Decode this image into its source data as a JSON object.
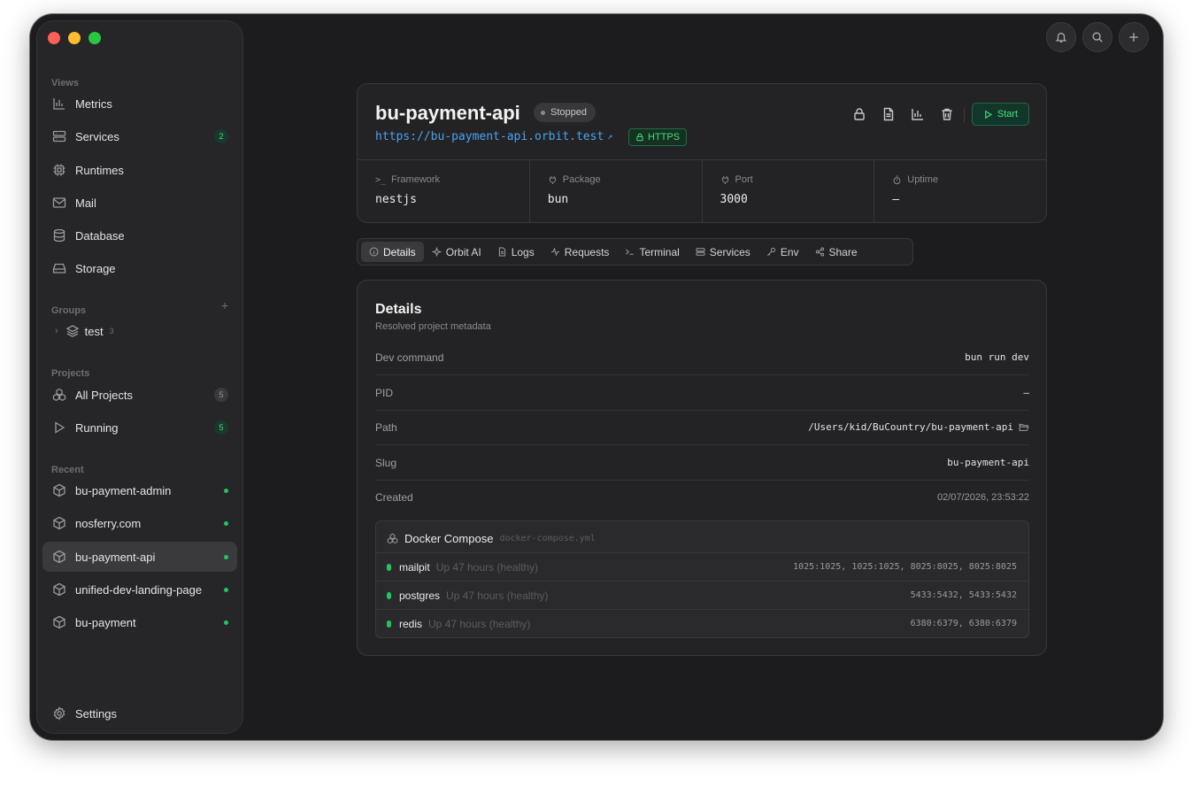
{
  "sidebar": {
    "views_label": "Views",
    "views": [
      {
        "label": "Metrics",
        "icon": "bar-chart-icon"
      },
      {
        "label": "Services",
        "icon": "server-icon",
        "badge": "2"
      },
      {
        "label": "Runtimes",
        "icon": "cpu-icon"
      },
      {
        "label": "Mail",
        "icon": "mail-icon"
      },
      {
        "label": "Database",
        "icon": "database-icon"
      },
      {
        "label": "Storage",
        "icon": "hard-drive-icon"
      }
    ],
    "groups_label": "Groups",
    "group": {
      "name": "test",
      "count": "3"
    },
    "projects_label": "Projects",
    "projects": [
      {
        "label": "All Projects",
        "badge": "5"
      },
      {
        "label": "Running",
        "badge": "5"
      }
    ],
    "recent_label": "Recent",
    "recent": [
      {
        "label": "bu-payment-admin"
      },
      {
        "label": "nosferry.com"
      },
      {
        "label": "bu-payment-api",
        "active": true
      },
      {
        "label": "unified-dev-landing-page"
      },
      {
        "label": "bu-payment"
      }
    ],
    "settings_label": "Settings"
  },
  "project": {
    "name": "bu-payment-api",
    "status": "Stopped",
    "url": "https://bu-payment-api.orbit.test",
    "https_label": "HTTPS",
    "start_label": "Start",
    "stats": [
      {
        "label": "Framework",
        "value": "nestjs"
      },
      {
        "label": "Package",
        "value": "bun"
      },
      {
        "label": "Port",
        "value": "3000"
      },
      {
        "label": "Uptime",
        "value": "—"
      }
    ]
  },
  "tabs": [
    "Details",
    "Orbit AI",
    "Logs",
    "Requests",
    "Terminal",
    "Services",
    "Env",
    "Share"
  ],
  "details": {
    "title": "Details",
    "subtitle": "Resolved project metadata",
    "rows": [
      {
        "key": "Dev command",
        "value": "bun run dev"
      },
      {
        "key": "PID",
        "value": "–"
      },
      {
        "key": "Path",
        "value": "/Users/kid/BuCountry/bu-payment-api"
      },
      {
        "key": "Slug",
        "value": "bu-payment-api"
      },
      {
        "key": "Created",
        "value": "02/07/2026, 23:53:22"
      }
    ],
    "docker": {
      "title": "Docker Compose",
      "file": "docker-compose.yml",
      "services": [
        {
          "name": "mailpit",
          "status": "Up 47 hours (healthy)",
          "ports": "1025:1025, 1025:1025, 8025:8025, 8025:8025"
        },
        {
          "name": "postgres",
          "status": "Up 47 hours (healthy)",
          "ports": "5433:5432, 5433:5432"
        },
        {
          "name": "redis",
          "status": "Up 47 hours (healthy)",
          "ports": "6380:6379, 6380:6379"
        }
      ]
    }
  }
}
